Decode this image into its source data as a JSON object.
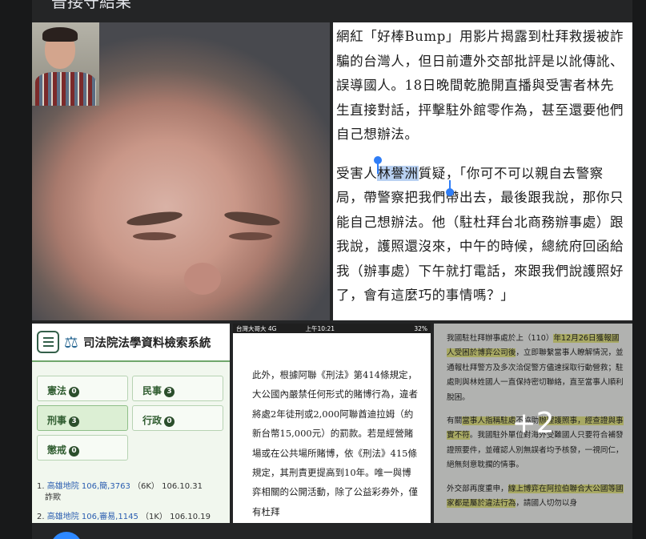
{
  "post": {
    "title_fragment": "普接守結果"
  },
  "video_tile": {},
  "article": {
    "p1": "網紅「好棒Bump」用影片揭露到杜拜救援被詐騙的台灣人，但日前遭外交部批評是以訛傳訛、誤導國人。18日晚間乾脆開直播與受害者林先生直接對話，抨擊駐外館零作為，甚至還要他們自己想辦法。",
    "p2_pre": "受害人",
    "p2_highlight": "林譽洲",
    "p2_post": "質疑，「你可不可以親自去警察局，帶警察把我們帶出去，最後跟我說，那你只能自己想辦法。他（駐杜拜台北商務辦事處）跟我說，護照還沒來，中午的時候，總統府回函給我（辦事處）下午就打電話，來跟我們說護照好了，會有這麼巧的事情嗎？」"
  },
  "judicial": {
    "title": "司法院法學資料檢索系統",
    "categories": [
      {
        "label": "憲法",
        "count": "0"
      },
      {
        "label": "民事",
        "count": "3"
      },
      {
        "label": "刑事",
        "count": "3"
      },
      {
        "label": "行政",
        "count": "0"
      },
      {
        "label": "懲戒",
        "count": "0"
      }
    ],
    "results": [
      {
        "num": "1.",
        "court": "高雄地院 106,簡,3763",
        "meta": "（6K） 106.10.31",
        "cause": "詐欺"
      },
      {
        "num": "2.",
        "court": "高雄地院 106,審易,1145",
        "meta": "（1K） 106.10.19",
        "cause": ""
      }
    ]
  },
  "phone": {
    "signal": "台灣大哥大 4G",
    "time": "上午10:21",
    "battery": "32%",
    "text": "此外，根據阿聯《刑法》第414條規定，大公國內嚴禁任何形式的賭博行為，違者將處2年徒刑或2,000阿聯酋迪拉姆（約新台幣15,000元）的罰款。若是經營賭場或在公共場所賭博，依《刑法》415條規定，其刑責更提高到10年。唯一與博弈相關的公開活動，除了公益彩券外，僅有杜拜"
  },
  "mofa": {
    "p1_a": "我國駐杜拜辦事處於上（110）",
    "p1_h1": "年12月26日獲報國人受困於博弈公司後",
    "p1_b": "，立即聯繫當事人瞭解情況，並通報杜拜警方及多次洽促警方儘速採取行動營救；駐處則與林姓國人一直保持密切聯絡，直至當事人順利脫困。",
    "p2_a": "有關",
    "p2_h1": "當事人指稱駐處",
    "p2_b": "不協助",
    "p2_h2": "辦理護照事，經查證與事實不符",
    "p2_c": "。我國駐外單位對海外受難國人只要符合補發證照要件，並確認人別無誤者均予核發，一視同仁，絕無刻意耽擱的情事。",
    "p3_a": "外交部再度重申，",
    "p3_h1": "線上博弈在阿拉伯聯合大公國等國家都是屬於違法行為",
    "p3_b": "，請國人切勿以身",
    "more_count": "+2"
  }
}
